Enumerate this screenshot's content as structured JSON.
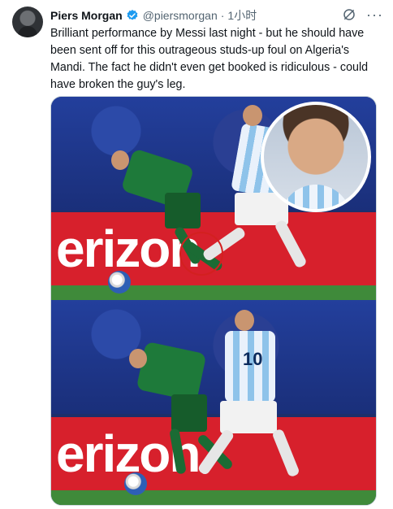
{
  "author": {
    "name": "Piers Morgan",
    "handle": "@piersmorgan",
    "separator": "·",
    "time": "1小时",
    "avatar_icon": "avatar-photo",
    "verified_icon": "verified-badge-icon",
    "verified_color": "#1d9bf0"
  },
  "actions": {
    "grok_icon": "grok-icon",
    "more_label": "···"
  },
  "tweet": {
    "text": "Brilliant performance by Messi last night - but he should have been sent off for this outrageous studs-up foul on Algeria's Mandi. The fact he didn't even get booked is ridiculous - could have broken the guy's leg."
  },
  "media": {
    "top_board_text": "erizon",
    "bottom_board_text": "erizon",
    "jersey_number": "10",
    "colors": {
      "board": "#d7202c",
      "pitch": "#3f8a3a",
      "algeria_kit": "#1e7a3a"
    }
  }
}
